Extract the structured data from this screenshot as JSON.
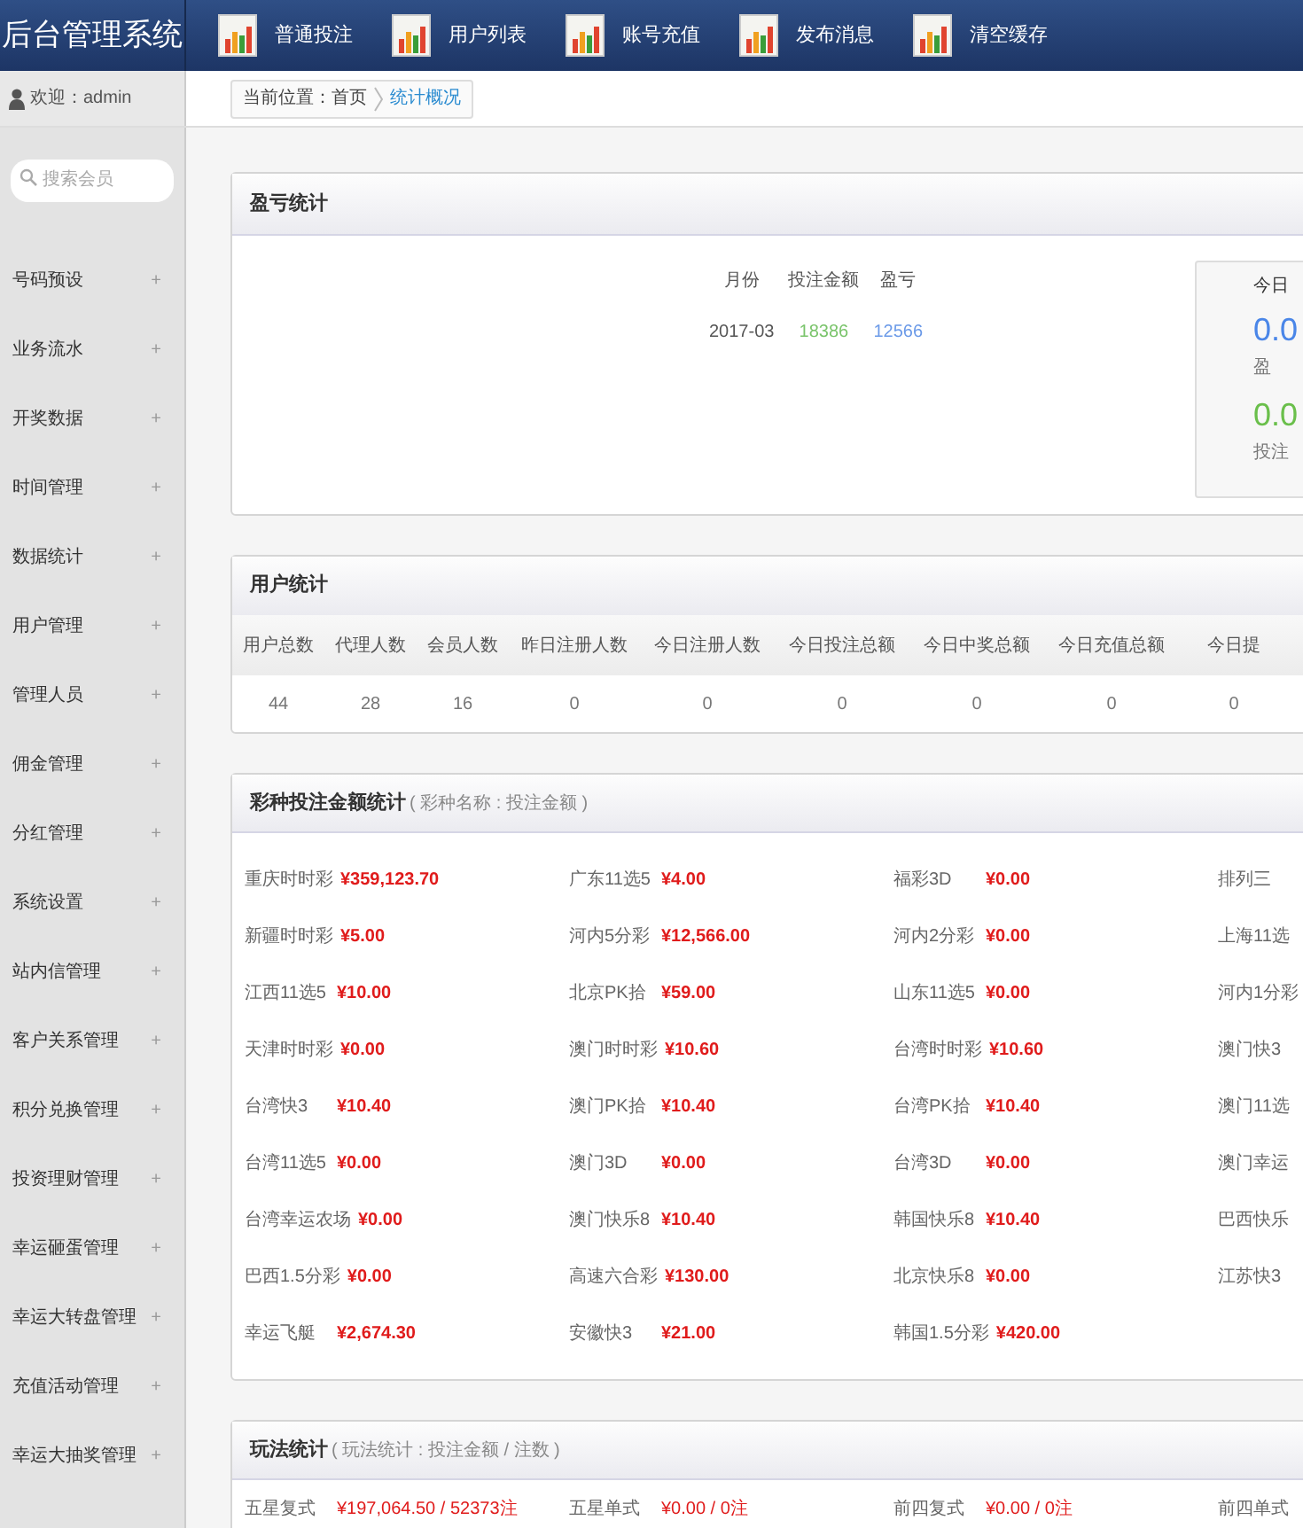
{
  "header": {
    "title": "后台管理系统",
    "nav": [
      {
        "label": "普通投注"
      },
      {
        "label": "用户列表"
      },
      {
        "label": "账号充值"
      },
      {
        "label": "发布消息"
      },
      {
        "label": "清空缓存"
      }
    ]
  },
  "welcome": "欢迎：admin",
  "breadcrumb": {
    "prefix": "当前位置：首页",
    "current": "统计概况"
  },
  "sidebar": {
    "search_placeholder": "搜索会员",
    "items": [
      {
        "label": "号码预设",
        "toggle": "+"
      },
      {
        "label": "业务流水",
        "toggle": "+"
      },
      {
        "label": "开奖数据",
        "toggle": "+"
      },
      {
        "label": "时间管理",
        "toggle": "+"
      },
      {
        "label": "数据统计",
        "toggle": "+"
      },
      {
        "label": "用户管理",
        "toggle": "+"
      },
      {
        "label": "管理人员",
        "toggle": "+"
      },
      {
        "label": "佣金管理",
        "toggle": "+"
      },
      {
        "label": "分红管理",
        "toggle": "+"
      },
      {
        "label": "系统设置",
        "toggle": "+"
      },
      {
        "label": "站内信管理",
        "toggle": "+"
      },
      {
        "label": "客户关系管理",
        "toggle": "+"
      },
      {
        "label": "积分兑换管理",
        "toggle": "+"
      },
      {
        "label": "投资理财管理",
        "toggle": "+"
      },
      {
        "label": "幸运砸蛋管理",
        "toggle": "+"
      },
      {
        "label": "幸运大转盘管理",
        "toggle": "+"
      },
      {
        "label": "充值活动管理",
        "toggle": "+"
      },
      {
        "label": "幸运大抽奖管理",
        "toggle": "+"
      }
    ]
  },
  "profit_panel": {
    "title": "盈亏统计",
    "columns": [
      "月份",
      "投注金额",
      "盈亏"
    ],
    "rows": [
      [
        "2017-03",
        "18386",
        "12566"
      ]
    ],
    "today_card": {
      "title": "今日",
      "profit_value": "0.0",
      "profit_label": "盈",
      "bet_value": "0.0",
      "bet_label": "投注"
    }
  },
  "user_panel": {
    "title": "用户统计",
    "columns": [
      "用户总数",
      "代理人数",
      "会员人数",
      "昨日注册人数",
      "今日注册人数",
      "今日投注总额",
      "今日中奖总额",
      "今日充值总额",
      "今日提"
    ],
    "values": [
      "44",
      "28",
      "16",
      "0",
      "0",
      "0",
      "0",
      "0",
      "0"
    ]
  },
  "lottery_panel": {
    "title": "彩种投注金额统计",
    "subtitle": "( 彩种名称 : 投注金额 )",
    "columns": [
      [
        {
          "name": "重庆时时彩",
          "amount": "¥359,123.70"
        },
        {
          "name": "新疆时时彩",
          "amount": "¥5.00"
        },
        {
          "name": "江西11选5",
          "amount": "¥10.00"
        },
        {
          "name": "天津时时彩",
          "amount": "¥0.00"
        },
        {
          "name": "台湾快3",
          "amount": "¥10.40"
        },
        {
          "name": "台湾11选5",
          "amount": "¥0.00"
        },
        {
          "name": "台湾幸运农场",
          "amount": "¥0.00"
        },
        {
          "name": "巴西1.5分彩",
          "amount": "¥0.00"
        },
        {
          "name": "幸运飞艇",
          "amount": "¥2,674.30"
        }
      ],
      [
        {
          "name": "广东11选5",
          "amount": "¥4.00"
        },
        {
          "name": "河内5分彩",
          "amount": "¥12,566.00"
        },
        {
          "name": "北京PK拾",
          "amount": "¥59.00"
        },
        {
          "name": "澳门时时彩",
          "amount": "¥10.60"
        },
        {
          "name": "澳门PK拾",
          "amount": "¥10.40"
        },
        {
          "name": "澳门3D",
          "amount": "¥0.00"
        },
        {
          "name": "澳门快乐8",
          "amount": "¥10.40"
        },
        {
          "name": "高速六合彩",
          "amount": "¥130.00"
        },
        {
          "name": "安徽快3",
          "amount": "¥21.00"
        }
      ],
      [
        {
          "name": "福彩3D",
          "amount": "¥0.00"
        },
        {
          "name": "河内2分彩",
          "amount": "¥0.00"
        },
        {
          "name": "山东11选5",
          "amount": "¥0.00"
        },
        {
          "name": "台湾时时彩",
          "amount": "¥10.60"
        },
        {
          "name": "台湾PK拾",
          "amount": "¥10.40"
        },
        {
          "name": "台湾3D",
          "amount": "¥0.00"
        },
        {
          "name": "韩国快乐8",
          "amount": "¥10.40"
        },
        {
          "name": "北京快乐8",
          "amount": "¥0.00"
        },
        {
          "name": "韩国1.5分彩",
          "amount": "¥420.00"
        }
      ],
      [
        {
          "name": "排列三"
        },
        {
          "name": "上海11选"
        },
        {
          "name": "河内1分彩"
        },
        {
          "name": "澳门快3"
        },
        {
          "name": "澳门11选"
        },
        {
          "name": "澳门幸运"
        },
        {
          "name": "巴西快乐"
        },
        {
          "name": "江苏快3"
        }
      ]
    ]
  },
  "play_panel": {
    "title": "玩法统计",
    "subtitle": "( 玩法统计 : 投注金额 / 注数 )",
    "items": [
      {
        "name": "五星复式",
        "amount": "¥197,064.50 / 52373注"
      },
      {
        "name": "五星单式",
        "amount": "¥0.00 / 0注"
      },
      {
        "name": "前四复式",
        "amount": "¥0.00 / 0注"
      },
      {
        "name": "前四单式"
      }
    ]
  }
}
